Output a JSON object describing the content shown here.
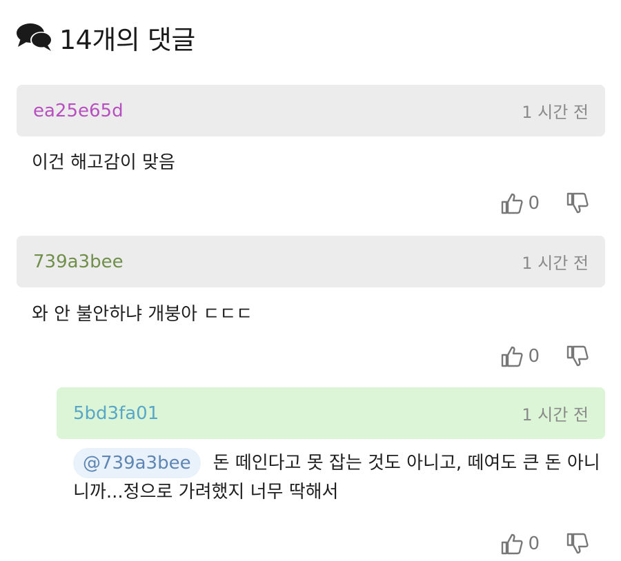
{
  "header": {
    "title": "14개의 댓글",
    "icon": "chat-bubbles-icon"
  },
  "colors": {
    "author1": "#b84fc0",
    "author2": "#6f8f4a",
    "author3": "#58a7c7",
    "mention": "#5d86b5"
  },
  "comments": [
    {
      "author": "ea25e65d",
      "time": "1 시간 전",
      "text": "이건 해고감이 맞음",
      "likes": "0"
    },
    {
      "author": "739a3bee",
      "time": "1 시간 전",
      "text": "와 안 불안하냐 개붕아 ㄷㄷㄷ",
      "likes": "0"
    },
    {
      "author": "5bd3fa01",
      "time": "1 시간 전",
      "mention": "@739a3bee",
      "text": "돈 떼인다고 못 잡는 것도 아니고, 떼여도 큰 돈 아니니까...정으로 가려했지 너무 딱해서",
      "likes": "0"
    }
  ]
}
